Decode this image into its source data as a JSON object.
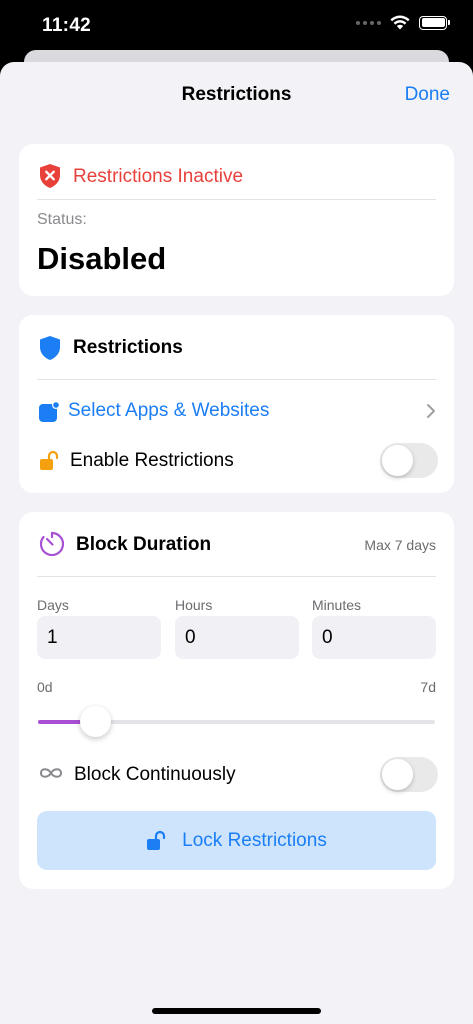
{
  "status_bar": {
    "time": "11:42"
  },
  "nav": {
    "title": "Restrictions",
    "done_label": "Done"
  },
  "status_card": {
    "title": "Restrictions Inactive",
    "status_label": "Status:",
    "status_value": "Disabled"
  },
  "restrictions_card": {
    "title": "Restrictions",
    "select_label": "Select Apps & Websites",
    "enable_label": "Enable Restrictions",
    "enable_on": false
  },
  "duration_card": {
    "title": "Block Duration",
    "max_label": "Max 7 days",
    "fields": [
      {
        "label": "Days",
        "value": "1"
      },
      {
        "label": "Hours",
        "value": "0"
      },
      {
        "label": "Minutes",
        "value": "0"
      }
    ],
    "slider": {
      "min_label": "0d",
      "max_label": "7d",
      "value_days": 1,
      "max_days": 7
    },
    "continuous_label": "Block Continuously",
    "continuous_on": false,
    "lock_button_label": "Lock Restrictions"
  },
  "colors": {
    "accent_blue": "#1b7ef5",
    "inactive_red": "#e8413b",
    "timer_purple": "#a94fd4",
    "lock_orange": "#f5a00f"
  },
  "icons": {
    "status": "shield-x-icon",
    "restrictions": "shield-icon",
    "select_apps": "app-badge-icon",
    "enable": "lock-open-icon",
    "duration": "timer-icon",
    "continuous": "infinity-icon",
    "lock_button": "lock-open-icon"
  }
}
